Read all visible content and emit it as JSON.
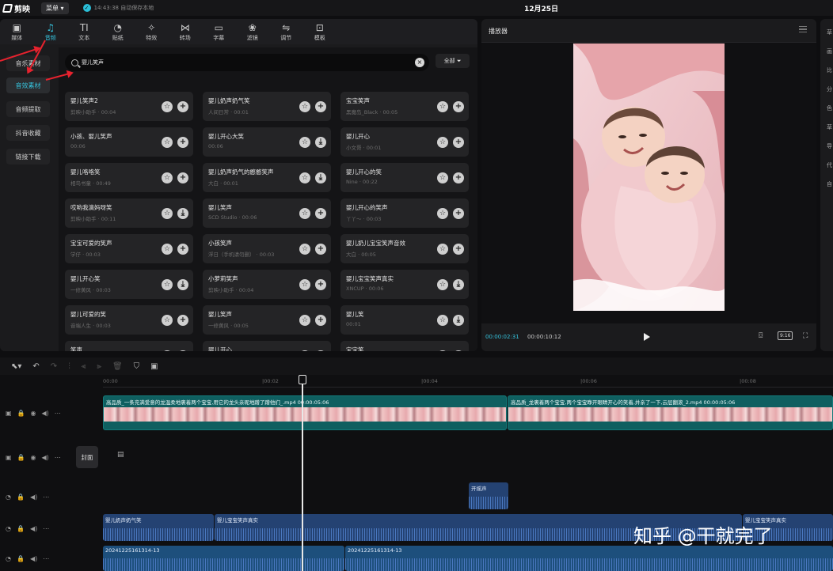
{
  "app": {
    "name": "剪映",
    "menu_label": "菜单",
    "save_status": "14:43:38 自动保存本地",
    "project_title": "12月25日"
  },
  "toolbar": [
    {
      "label": "媒体",
      "icon": "media-icon"
    },
    {
      "label": "音频",
      "icon": "audio-icon",
      "active": true
    },
    {
      "label": "文本",
      "icon": "text-icon"
    },
    {
      "label": "贴纸",
      "icon": "sticker-icon"
    },
    {
      "label": "特效",
      "icon": "effect-icon"
    },
    {
      "label": "转场",
      "icon": "transition-icon"
    },
    {
      "label": "字幕",
      "icon": "caption-icon"
    },
    {
      "label": "滤镜",
      "icon": "filter-icon"
    },
    {
      "label": "调节",
      "icon": "adjust-icon"
    },
    {
      "label": "模板",
      "icon": "template-icon"
    }
  ],
  "sidebar": [
    "音乐素材",
    "音效素材",
    "音频提取",
    "抖音收藏",
    "链接下载"
  ],
  "search": {
    "value": "婴儿笑声",
    "filter_label": "全部"
  },
  "sounds": [
    {
      "title": "婴儿笑声2",
      "meta": "剪映小助手 · 00:04"
    },
    {
      "title": "婴儿奶声奶气笑",
      "meta": "人间日常 · 00:01"
    },
    {
      "title": "宝宝笑声",
      "meta": "黑魔岛_Black · 00:05"
    },
    {
      "title": "小孩、婴儿笑声",
      "meta": "00:06"
    },
    {
      "title": "婴儿开心大笑",
      "meta": "00:06"
    },
    {
      "title": "婴儿开心",
      "meta": "小文哥 · 00:01"
    },
    {
      "title": "婴儿咯咯笑",
      "meta": "相鸟书童 · 00:49"
    },
    {
      "title": "婴儿奶声奶气的憨憨笑声",
      "meta": "大白 · 00:01"
    },
    {
      "title": "婴儿开心的笑",
      "meta": "Nine · 00:22"
    },
    {
      "title": "哎哟我滴妈呀笑",
      "meta": "剪映小助手 · 00:11"
    },
    {
      "title": "婴儿笑声",
      "meta": "SCD Studio · 00:06"
    },
    {
      "title": "婴儿开心的笑声",
      "meta": "丫丫～ · 00:03"
    },
    {
      "title": "宝宝可爱的笑声",
      "meta": "学仔 · 00:03"
    },
    {
      "title": "小孩笑声",
      "meta": "浮日（手机请勿删） · 00:03"
    },
    {
      "title": "婴儿奶儿宝宝笑声音效",
      "meta": "大白 · 00:05"
    },
    {
      "title": "婴儿开心笑",
      "meta": "一修黄风 · 00:03"
    },
    {
      "title": "小萝莉笑声",
      "meta": "剪映小助手 · 00:04"
    },
    {
      "title": "婴儿宝宝笑声真实",
      "meta": "XNCUP · 00:06"
    },
    {
      "title": "婴儿可爱的笑",
      "meta": "音端人生 · 00:03"
    },
    {
      "title": "婴儿笑声",
      "meta": "一修黄风 · 00:05"
    },
    {
      "title": "婴儿笑",
      "meta": "00:01"
    },
    {
      "title": "笑声",
      "meta": ""
    },
    {
      "title": "婴儿开心",
      "meta": ""
    },
    {
      "title": "宝宝笑",
      "meta": ""
    }
  ],
  "player": {
    "title": "播放器",
    "time_current": "00:00:02:31",
    "time_total": "00:00:10:12",
    "ratio": "9:16"
  },
  "right_panel": [
    "草",
    "画",
    "比",
    "分",
    "色",
    "草",
    "导",
    "代",
    "自"
  ],
  "timeline": {
    "ruler": [
      "00:00",
      "|00:02",
      "|00:04",
      "|00:06",
      "|00:08"
    ],
    "video_clips": [
      {
        "label": "高品质_一条充满爱意的龙温柔地裹着两个宝宝,用它的龙头亲昵地蹭了蹭他们_.mp4  00:00:05:06"
      },
      {
        "label": "高品质_龙裹着两个宝宝,两个宝宝睁开眼睛开心的笑着,并亲了一下,云层翻滚_2.mp4  00:00:05:06"
      }
    ],
    "cover_label": "封面",
    "audio_clips": [
      {
        "label": "开摇声"
      },
      {
        "label": "婴儿奶声奶气笑"
      },
      {
        "label": "婴儿宝宝笑声真实"
      },
      {
        "label": "婴儿宝宝笑声真实"
      },
      {
        "label": "20241225161314-13"
      },
      {
        "label": "20241225161314-13"
      }
    ]
  },
  "watermark": "知乎 @干就完了"
}
